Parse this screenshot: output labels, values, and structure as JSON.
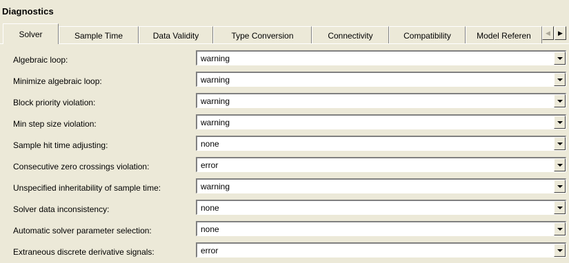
{
  "title": "Diagnostics",
  "tabs": [
    {
      "label": "Solver",
      "active": true
    },
    {
      "label": "Sample Time"
    },
    {
      "label": "Data Validity"
    },
    {
      "label": "Type Conversion"
    },
    {
      "label": "Connectivity"
    },
    {
      "label": "Compatibility"
    },
    {
      "label": "Model Referen"
    }
  ],
  "rows": [
    {
      "label": "Algebraic loop:",
      "value": "warning"
    },
    {
      "label": "Minimize algebraic loop:",
      "value": "warning"
    },
    {
      "label": "Block priority violation:",
      "value": "warning"
    },
    {
      "label": "Min step size violation:",
      "value": "warning"
    },
    {
      "label": "Sample hit time adjusting:",
      "value": "none"
    },
    {
      "label": "Consecutive zero crossings violation:",
      "value": "error"
    },
    {
      "label": "Unspecified inheritability of sample time:",
      "value": "warning"
    },
    {
      "label": "Solver data inconsistency:",
      "value": "none"
    },
    {
      "label": "Automatic solver parameter selection:",
      "value": "none"
    },
    {
      "label": "Extraneous discrete derivative signals:",
      "value": "error"
    }
  ]
}
